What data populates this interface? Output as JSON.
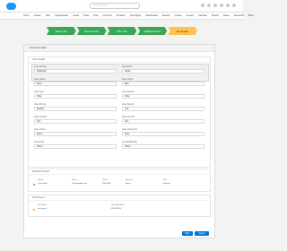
{
  "topbar": {
    "search_placeholder": "Search Salesforce"
  },
  "nav": {
    "items": [
      "Home",
      "Chatter",
      "Files",
      "Opportunities",
      "Leads",
      "Tasks",
      "Files",
      "Accounts",
      "Contacts",
      "Campaigns",
      "Dashboards",
      "Reports",
      "Quotes",
      "Groups",
      "Calendar",
      "People",
      "Cases",
      "Forecasts",
      "More"
    ]
  },
  "path": {
    "steps": [
      "Basic Info",
      "Service Info",
      "Plan Info",
      "Additional Info",
      "Summary"
    ],
    "current_index": 4
  },
  "card": {
    "header": "Case Information",
    "sections": {
      "details": {
        "title": "Case Details",
        "fields": [
          {
            "label": "Case Number",
            "value": "00001026"
          },
          {
            "label": "Description",
            "value": "00004"
          },
          {
            "label": "Case Status",
            "value": "Open"
          },
          {
            "label": "Case Origin",
            "value": "Web"
          },
          {
            "label": "Case Type",
            "value": "Other"
          },
          {
            "label": "Case Reason",
            "value": "Other"
          },
          {
            "label": "Case Priority",
            "value": "Medium"
          },
          {
            "label": "Case Subject",
            "value": "Test"
          },
          {
            "label": "Case Contact",
            "value": "Test"
          },
          {
            "label": "Case Account",
            "value": "Test"
          },
          {
            "label": "Case Owner",
            "value": "Admin"
          },
          {
            "label": "Case Comments",
            "value": "None"
          },
          {
            "label": "Created By",
            "value": "Admin"
          },
          {
            "label": "Last Modified By",
            "value": "Admin"
          }
        ]
      },
      "contacts": {
        "title": "Related Contacts",
        "headers": [
          "Name",
          "Email",
          "Phone",
          "Account",
          "Role"
        ],
        "row": {
          "name": "John Smith",
          "email": "js@example.com",
          "phone": "555-0100",
          "account": "Acme",
          "role": "Primary"
        }
      },
      "attachments": {
        "title": "Attachments",
        "headers": [
          "File Name",
          "Uploaded Date"
        ],
        "row": {
          "name": "Document",
          "date": "01/01/2020"
        }
      }
    }
  },
  "buttons": {
    "back": "Back",
    "submit": "Submit"
  },
  "colors": {
    "path_complete": "#3ba755",
    "path_current": "#ffc34d",
    "brand": "#0176d3"
  }
}
